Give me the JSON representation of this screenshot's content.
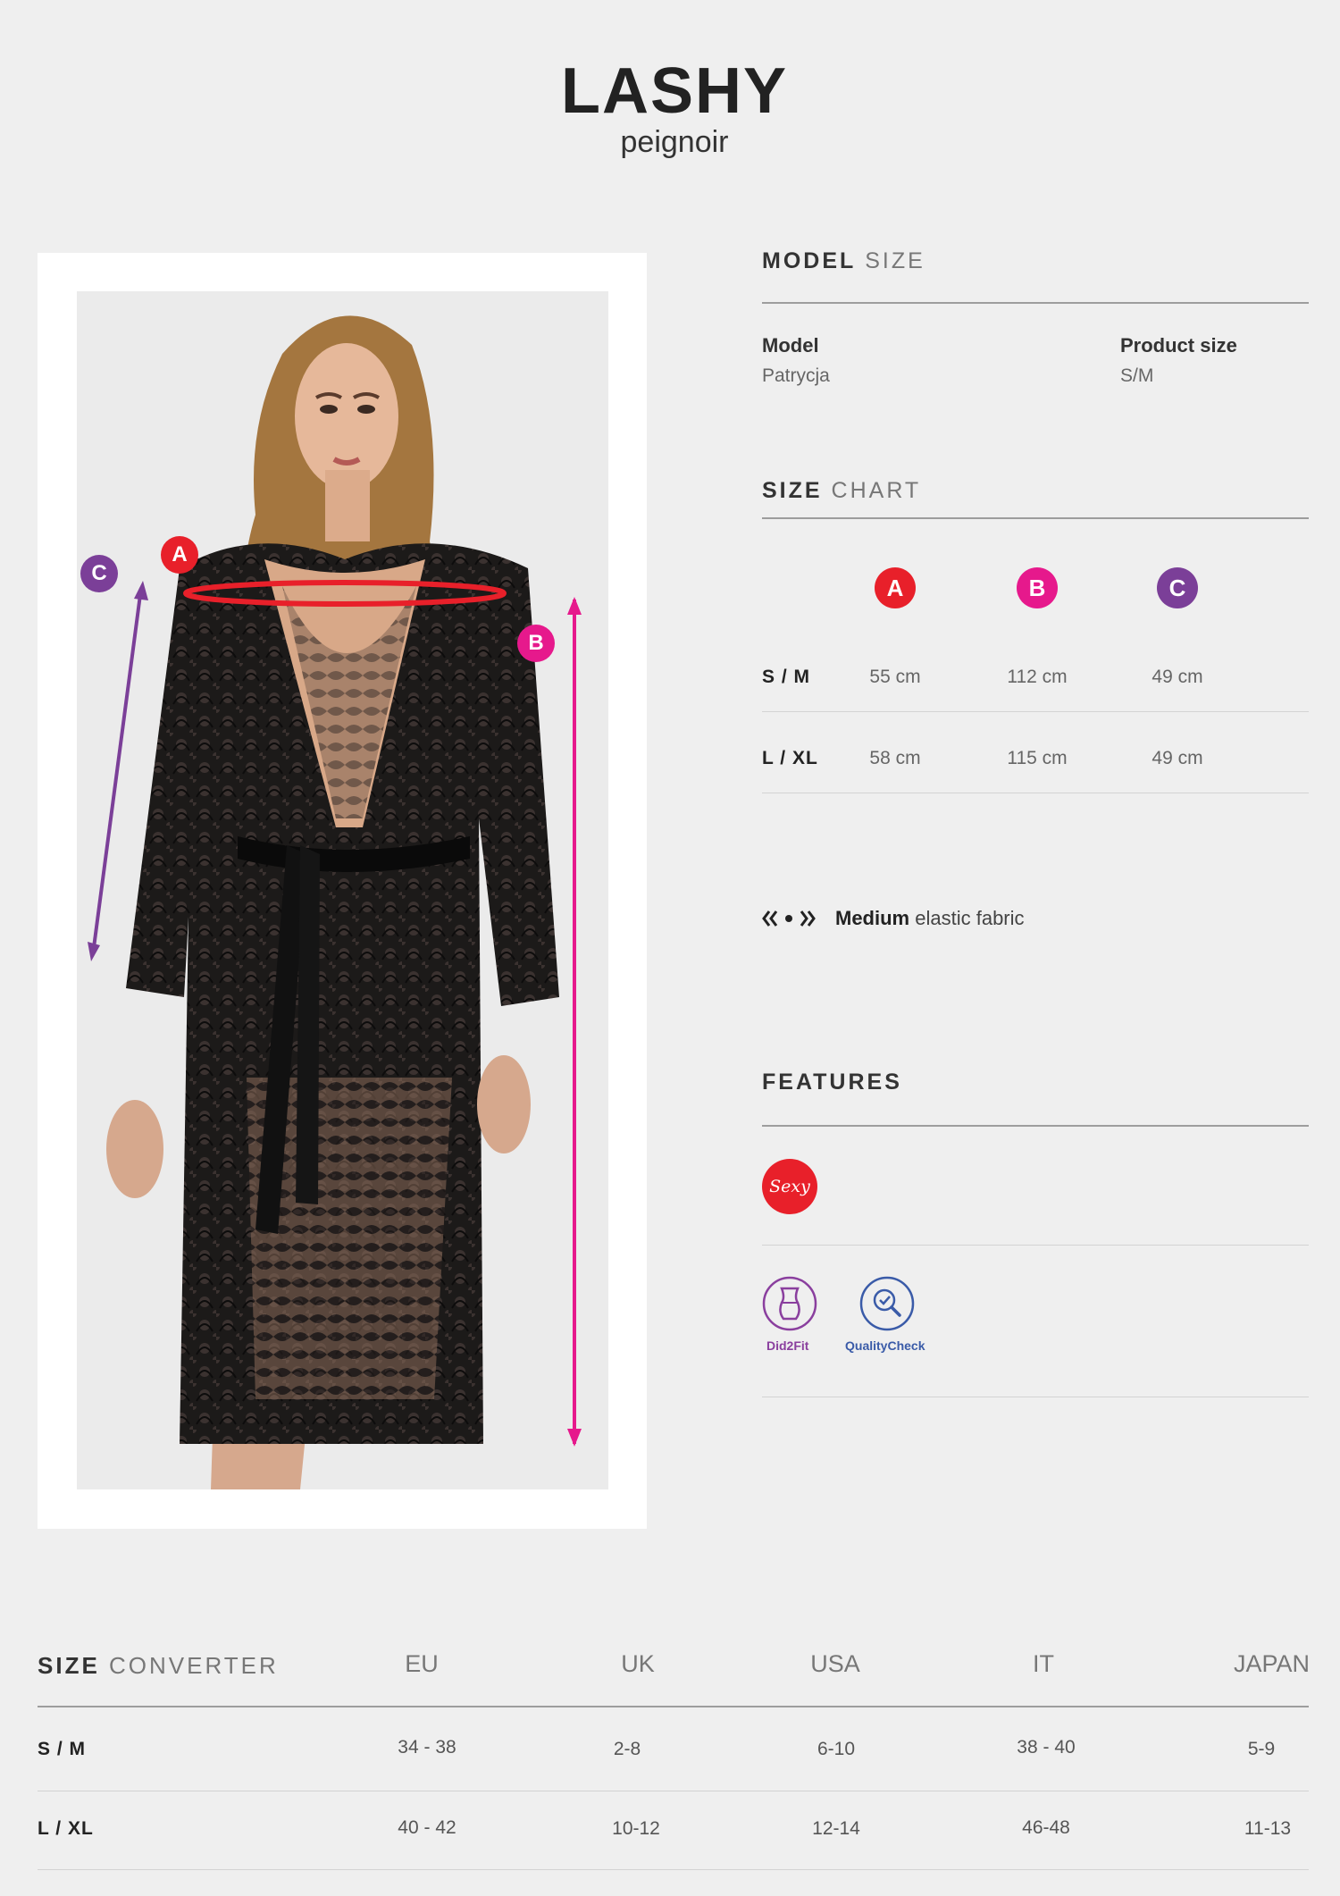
{
  "product": {
    "name": "LASHY",
    "type": "peignoir"
  },
  "markers": {
    "a": "A",
    "b": "B",
    "c": "C"
  },
  "model_size": {
    "heading_bold": "MODEL",
    "heading_light": "SIZE",
    "model_label": "Model",
    "model_value": "Patrycja",
    "product_size_label": "Product size",
    "product_size_value": "S/M"
  },
  "size_chart": {
    "heading_bold": "SIZE",
    "heading_light": "CHART",
    "columns": [
      "A",
      "B",
      "C"
    ],
    "rows": [
      {
        "size": "S / M",
        "values": [
          "55 cm",
          "112 cm",
          "49 cm"
        ]
      },
      {
        "size": "L / XL",
        "values": [
          "58 cm",
          "115 cm",
          "49 cm"
        ]
      }
    ]
  },
  "fabric": {
    "icon": "elasticity-icon",
    "bold": "Medium",
    "text": "elastic fabric"
  },
  "features": {
    "heading": "FEATURES",
    "badge_text": "Sexy",
    "icons": [
      {
        "name": "did2fit-icon",
        "label": "Did2Fit",
        "color": "#8a3f9e"
      },
      {
        "name": "quality-check-icon",
        "label": "QualityCheck",
        "color": "#3a5ba8"
      }
    ]
  },
  "converter": {
    "heading_bold": "SIZE",
    "heading_light": "CONVERTER",
    "columns": [
      "EU",
      "UK",
      "USA",
      "IT",
      "JAPAN"
    ],
    "rows": [
      {
        "size": "S / M",
        "values": [
          "34 - 38",
          "2-8",
          "6-10",
          "38 - 40",
          "5-9"
        ]
      },
      {
        "size": "L / XL",
        "values": [
          "40 - 42",
          "10-12",
          "12-14",
          "46-48",
          "11-13"
        ]
      }
    ]
  },
  "colors": {
    "accent_a": "#e8202a",
    "accent_b": "#e6198c",
    "accent_c": "#7b3f98"
  }
}
